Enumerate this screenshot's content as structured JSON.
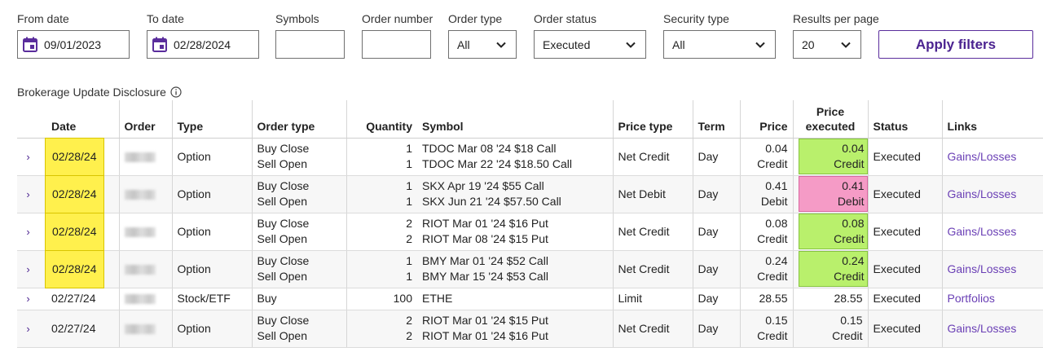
{
  "filters": {
    "from_date": {
      "label": "From date",
      "value": "09/01/2023"
    },
    "to_date": {
      "label": "To date",
      "value": "02/28/2024"
    },
    "symbols": {
      "label": "Symbols",
      "value": ""
    },
    "order_number": {
      "label": "Order number",
      "value": ""
    },
    "order_type": {
      "label": "Order type",
      "value": "All"
    },
    "order_status": {
      "label": "Order status",
      "value": "Executed"
    },
    "security_type": {
      "label": "Security type",
      "value": "All"
    },
    "results_per_page": {
      "label": "Results per page",
      "value": "20"
    },
    "apply_label": "Apply filters"
  },
  "disclosure": "Brokerage Update Disclosure",
  "colors": {
    "accent": "#4b2390",
    "highlight_yellow": "#fff04d",
    "highlight_green": "#b9f06c",
    "highlight_pink": "#f59bc6"
  },
  "table": {
    "headers": {
      "date": "Date",
      "order": "Order",
      "type": "Type",
      "order_type": "Order type",
      "quantity": "Quantity",
      "symbol": "Symbol",
      "price_type": "Price type",
      "term": "Term",
      "price": "Price",
      "price_executed_1": "Price",
      "price_executed_2": "executed",
      "status": "Status",
      "links": "Links"
    },
    "rows": [
      {
        "date": "02/28/24",
        "type": "Option",
        "ot1": "Buy Close",
        "ot2": "Sell Open",
        "q1": "1",
        "q2": "1",
        "s1": "TDOC Mar 08 '24 $18 Call",
        "s2": "TDOC Mar 22 '24 $18.50 Call",
        "price_type": "Net Credit",
        "term": "Day",
        "p1": "0.04",
        "p2": "Credit",
        "pe1": "0.04",
        "pe2": "Credit",
        "status": "Executed",
        "link": "Gains/Losses"
      },
      {
        "date": "02/28/24",
        "type": "Option",
        "ot1": "Buy Close",
        "ot2": "Sell Open",
        "q1": "1",
        "q2": "1",
        "s1": "SKX Apr 19 '24 $55 Call",
        "s2": "SKX Jun 21 '24 $57.50 Call",
        "price_type": "Net Debit",
        "term": "Day",
        "p1": "0.41",
        "p2": "Debit",
        "pe1": "0.41",
        "pe2": "Debit",
        "status": "Executed",
        "link": "Gains/Losses"
      },
      {
        "date": "02/28/24",
        "type": "Option",
        "ot1": "Buy Close",
        "ot2": "Sell Open",
        "q1": "2",
        "q2": "2",
        "s1": "RIOT Mar 01 '24 $16 Put",
        "s2": "RIOT Mar 08 '24 $15 Put",
        "price_type": "Net Credit",
        "term": "Day",
        "p1": "0.08",
        "p2": "Credit",
        "pe1": "0.08",
        "pe2": "Credit",
        "status": "Executed",
        "link": "Gains/Losses"
      },
      {
        "date": "02/28/24",
        "type": "Option",
        "ot1": "Buy Close",
        "ot2": "Sell Open",
        "q1": "1",
        "q2": "1",
        "s1": "BMY Mar 01 '24 $52 Call",
        "s2": "BMY Mar 15 '24 $53 Call",
        "price_type": "Net Credit",
        "term": "Day",
        "p1": "0.24",
        "p2": "Credit",
        "pe1": "0.24",
        "pe2": "Credit",
        "status": "Executed",
        "link": "Gains/Losses"
      },
      {
        "date": "02/27/24",
        "type": "Stock/ETF",
        "ot1": "Buy",
        "q1": "100",
        "s1": "ETHE",
        "price_type": "Limit",
        "term": "Day",
        "p1": "28.55",
        "pe1": "28.55",
        "status": "Executed",
        "link": "Portfolios"
      },
      {
        "date": "02/27/24",
        "type": "Option",
        "ot1": "Buy Close",
        "ot2": "Sell Open",
        "q1": "2",
        "q2": "2",
        "s1": "RIOT Mar 01 '24 $15 Put",
        "s2": "RIOT Mar 01 '24 $16 Put",
        "price_type": "Net Credit",
        "term": "Day",
        "p1": "0.15",
        "p2": "Credit",
        "pe1": "0.15",
        "pe2": "Credit",
        "status": "Executed",
        "link": "Gains/Losses"
      }
    ]
  }
}
